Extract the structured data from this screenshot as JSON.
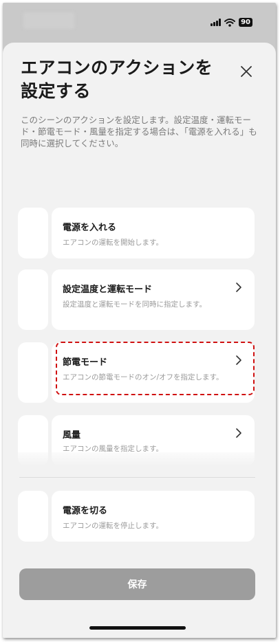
{
  "status_bar": {
    "battery_level": "90",
    "icons": [
      "signal-icon",
      "wifi-icon",
      "battery-icon"
    ]
  },
  "sheet": {
    "title": "エアコンのアクションを設定する",
    "close_icon": "close-icon",
    "description": "このシーンのアクションを設定します。設定温度・運転モード・節電モード・風量を指定する場合は、「電源を入れる」も同時に選択してください。"
  },
  "actions": [
    {
      "title": "電源を入れる",
      "description": "エアコンの運転を開始します。",
      "has_chevron": false
    },
    {
      "title": "設定温度と運転モード",
      "description": "設定温度と運転モードを同時に指定します。",
      "has_chevron": true
    },
    {
      "title": "節電モード",
      "description": "エアコンの節電モードのオン/オフを指定します。",
      "has_chevron": true,
      "highlighted": true
    },
    {
      "title": "風量",
      "description": "エアコンの風量を指定します。",
      "has_chevron": true
    },
    {
      "title": "電源を切る",
      "description": "エアコンの運転を停止します。",
      "has_chevron": false
    }
  ],
  "footer": {
    "save_label": "保存"
  },
  "colors": {
    "sheet_background": "#f2f2f2",
    "card_background": "#ffffff",
    "save_button": "#9d9d9d",
    "highlight": "#d01010",
    "status_background": "#c9c9c9"
  }
}
